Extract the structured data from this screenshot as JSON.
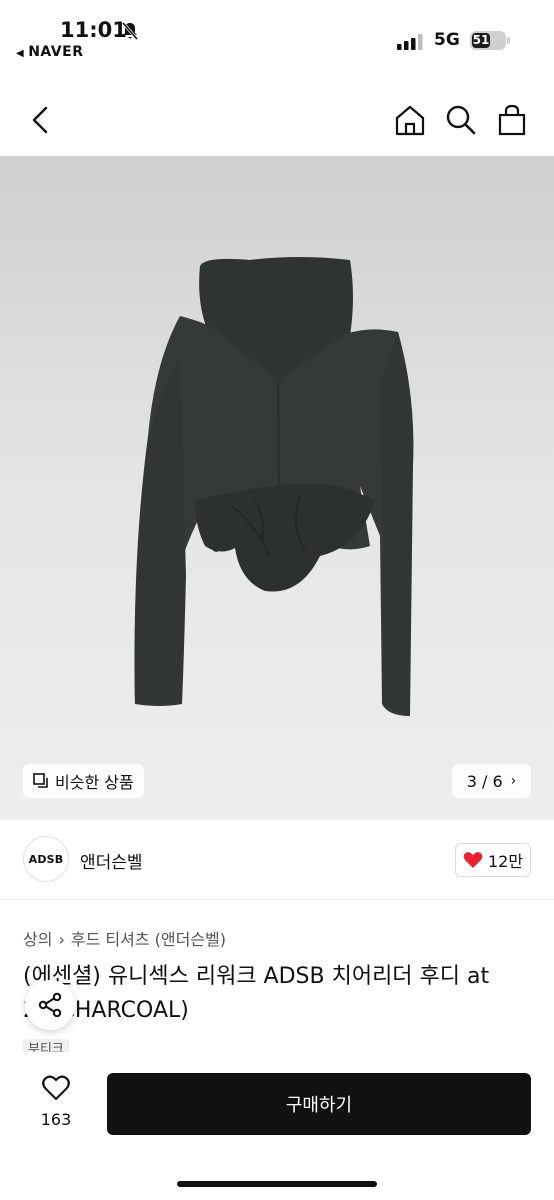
{
  "status_bar": {
    "time": "11:01",
    "back_app": "NAVER",
    "network": "5G",
    "battery": "51"
  },
  "nav": {
    "icons": [
      "back-chevron-icon",
      "home-icon",
      "search-icon",
      "shopping-bag-icon"
    ]
  },
  "gallery": {
    "similar_label": "비슷한 상품",
    "counter": "3 / 6"
  },
  "brand": {
    "logo_text": "ADSB",
    "name": "앤더슨벨",
    "likes": "12만"
  },
  "product": {
    "breadcrumb": [
      "상의",
      "후드 티셔츠 (앤더슨벨)"
    ],
    "title": "(에센셜) 유니섹스 리워크 ADSB 치어리더 후디 at 2u(CHARCOAL)",
    "tag": "부티크"
  },
  "bottom_bar": {
    "wish_count": "163",
    "buy_label": "구매하기"
  },
  "colors": {
    "buy_button": "#111111",
    "heart": "#e8212e",
    "garment": "#353937"
  }
}
